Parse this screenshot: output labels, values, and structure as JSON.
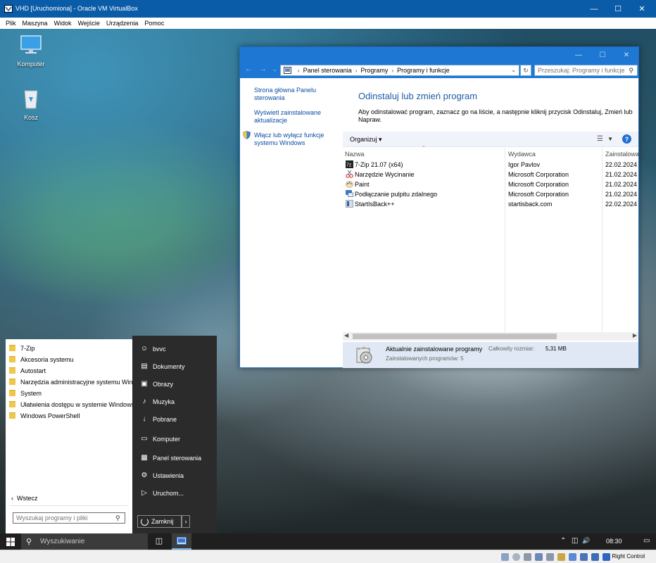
{
  "vbox": {
    "title": "VHD [Uruchomiona] - Oracle VM VirtualBox",
    "menu": [
      "Plik",
      "Maszyna",
      "Widok",
      "Wejście",
      "Urządzenia",
      "Pomoc"
    ],
    "host_key": "Right Control"
  },
  "desktop": {
    "icons": [
      {
        "label": "Komputer",
        "icon": "computer-icon"
      },
      {
        "label": "Kosz",
        "icon": "recycle-bin-icon"
      }
    ]
  },
  "cp": {
    "breadcrumb": [
      "Panel sterowania",
      "Programy",
      "Programy i funkcje"
    ],
    "search_placeholder": "Przeszukaj: Programy i funkcje",
    "left_links": [
      "Strona główna Panelu sterowania",
      "Wyświetl zainstalowane aktualizacje",
      "Włącz lub wyłącz funkcje systemu Windows"
    ],
    "heading": "Odinstaluj lub zmień program",
    "description": "Aby odinstalować program, zaznacz go na liście, a następnie kliknij przycisk Odinstaluj, Zmień lub Napraw.",
    "organize": "Organizuj",
    "columns": [
      "Nazwa",
      "Wydawca",
      "Zainstalowa..."
    ],
    "programs": [
      {
        "name": "7-Zip 21.07 (x64)",
        "publisher": "Igor Pavlov",
        "date": "22.02.2024",
        "icon": "7zip-icon"
      },
      {
        "name": "Narzędzie Wycinanie",
        "publisher": "Microsoft Corporation",
        "date": "21.02.2024",
        "icon": "snipping-tool-icon"
      },
      {
        "name": "Paint",
        "publisher": "Microsoft Corporation",
        "date": "21.02.2024",
        "icon": "paint-icon"
      },
      {
        "name": "Podłączanie pulpitu zdalnego",
        "publisher": "Microsoft Corporation",
        "date": "21.02.2024",
        "icon": "remote-desktop-icon"
      },
      {
        "name": "StartIsBack++",
        "publisher": "startisback.com",
        "date": "22.02.2024",
        "icon": "startisback-icon"
      }
    ],
    "status": {
      "title": "Aktualnie zainstalowane programy",
      "size_label": "Całkowity rozmiar:",
      "size_value": "5,31 MB",
      "count": "Zainstalowanych programów: 5"
    }
  },
  "start_menu": {
    "folders": [
      "7-Zip",
      "Akcesoria systemu",
      "Autostart",
      "Narzędzia administracyjne systemu Wind...",
      "System",
      "Ułatwienia dostępu w systemie Windows",
      "Windows PowerShell"
    ],
    "back": "Wstecz",
    "search_placeholder": "Wyszukaj programy i pliki",
    "right_items": [
      {
        "label": "bvvc",
        "icon": "user-icon"
      },
      {
        "label": "Dokumenty",
        "icon": "documents-icon"
      },
      {
        "label": "Obrazy",
        "icon": "pictures-icon"
      },
      {
        "label": "Muzyka",
        "icon": "music-icon"
      },
      {
        "label": "Pobrane",
        "icon": "downloads-icon"
      },
      {
        "label": "Komputer",
        "icon": "computer-icon"
      },
      {
        "label": "Panel sterowania",
        "icon": "control-panel-icon"
      },
      {
        "label": "Ustawienia",
        "icon": "settings-icon"
      },
      {
        "label": "Uruchom...",
        "icon": "run-icon"
      }
    ],
    "shutdown": "Zamknij"
  },
  "taskbar": {
    "search": "Wyszukiwanie",
    "time": "08:30"
  }
}
